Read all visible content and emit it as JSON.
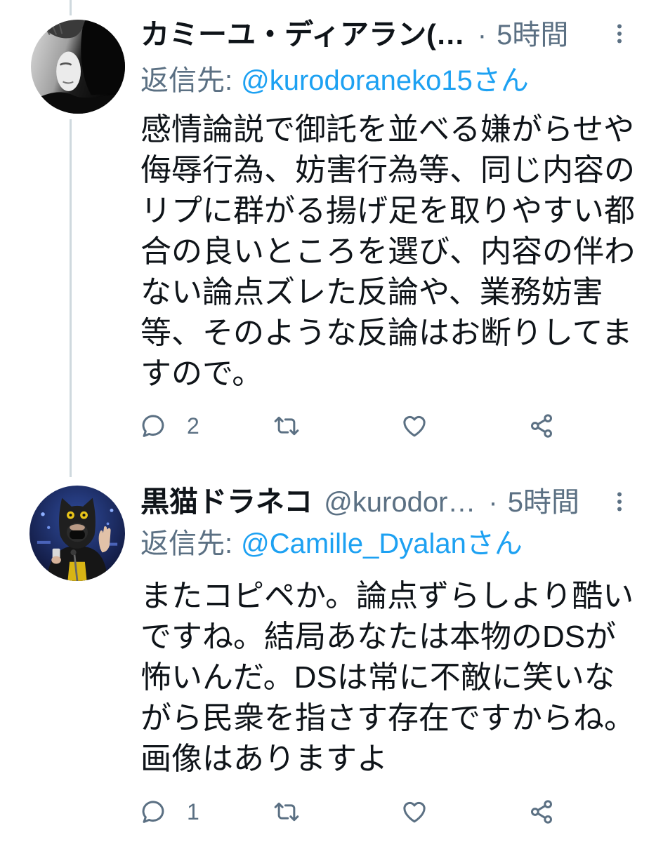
{
  "colors": {
    "text": "#0F1419",
    "secondary": "#5B7083",
    "link": "#1DA1F2",
    "thread_line": "#CFD9DE",
    "background": "#FFFFFF"
  },
  "tweets": [
    {
      "avatar": "user-avatar-photo",
      "display_name": "カミーユ・ディアラン(…",
      "separator": "·",
      "time": "5時間",
      "more_icon": "more-vertical-icon",
      "reply_to": {
        "label": "返信先:",
        "handle": "@kurodoraneko15さん"
      },
      "body_lines": [
        "感情論説で御託を並べる嫌がらせや",
        "侮辱行為、妨害行為等、同じ内容の",
        "リプに群がる揚げ足を取りやすい都",
        "合の良いところを選び、内容の伴わ",
        "ない論点ズレた反論や、業務妨害",
        "等、そのような反論はお断りしてま",
        "すので。"
      ],
      "actions": [
        {
          "icon": "reply-icon",
          "count": "2"
        },
        {
          "icon": "retweet-icon"
        },
        {
          "icon": "like-icon"
        },
        {
          "icon": "share-icon"
        }
      ]
    },
    {
      "avatar": "user-avatar-photo",
      "display_name": "黒猫ドラネコ",
      "handle": "@kurodor…",
      "separator": "·",
      "time": "5時間",
      "more_icon": "more-vertical-icon",
      "reply_to": {
        "label": "返信先:",
        "handle": "@Camille_Dyalanさん"
      },
      "body_lines": [
        "またコピペか。論点ずらしより酷い",
        "ですね。結局あなたは本物のDSが",
        "怖いんだ。DSは常に不敵に笑いな",
        "がら民衆を指さす存在ですからね。",
        "画像はありますよ"
      ],
      "actions": [
        {
          "icon": "reply-icon",
          "count": "1"
        },
        {
          "icon": "retweet-icon"
        },
        {
          "icon": "like-icon"
        },
        {
          "icon": "share-icon"
        }
      ]
    }
  ]
}
